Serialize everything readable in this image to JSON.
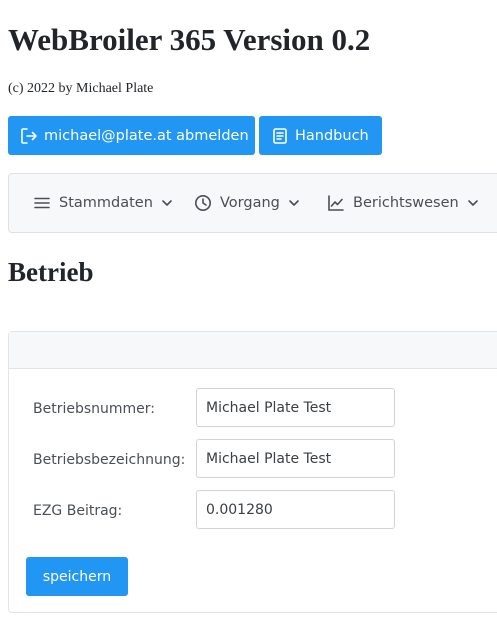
{
  "app": {
    "title": "WebBroiler 365 Version 0.2",
    "copyright": "(c) 2022 by Michael Plate"
  },
  "actions": {
    "logout_label": "michael@plate.at abmelden",
    "manual_label": "Handbuch"
  },
  "nav": {
    "items": [
      {
        "label": "Stammdaten",
        "icon": "menu-icon"
      },
      {
        "label": "Vorgang",
        "icon": "clock-icon"
      },
      {
        "label": "Berichtswesen",
        "icon": "chart-line-icon"
      }
    ]
  },
  "page": {
    "title": "Betrieb"
  },
  "form": {
    "fields": [
      {
        "label": "Betriebsnummer:",
        "value": "Michael Plate Test"
      },
      {
        "label": "Betriebsbezeichnung:",
        "value": "Michael Plate Test"
      },
      {
        "label": "EZG Beitrag:",
        "value": "0.001280"
      }
    ],
    "save_label": "speichern"
  },
  "colors": {
    "primary": "#2196f3",
    "navbar_bg": "#f7f8fa",
    "border": "#dee2e6"
  }
}
